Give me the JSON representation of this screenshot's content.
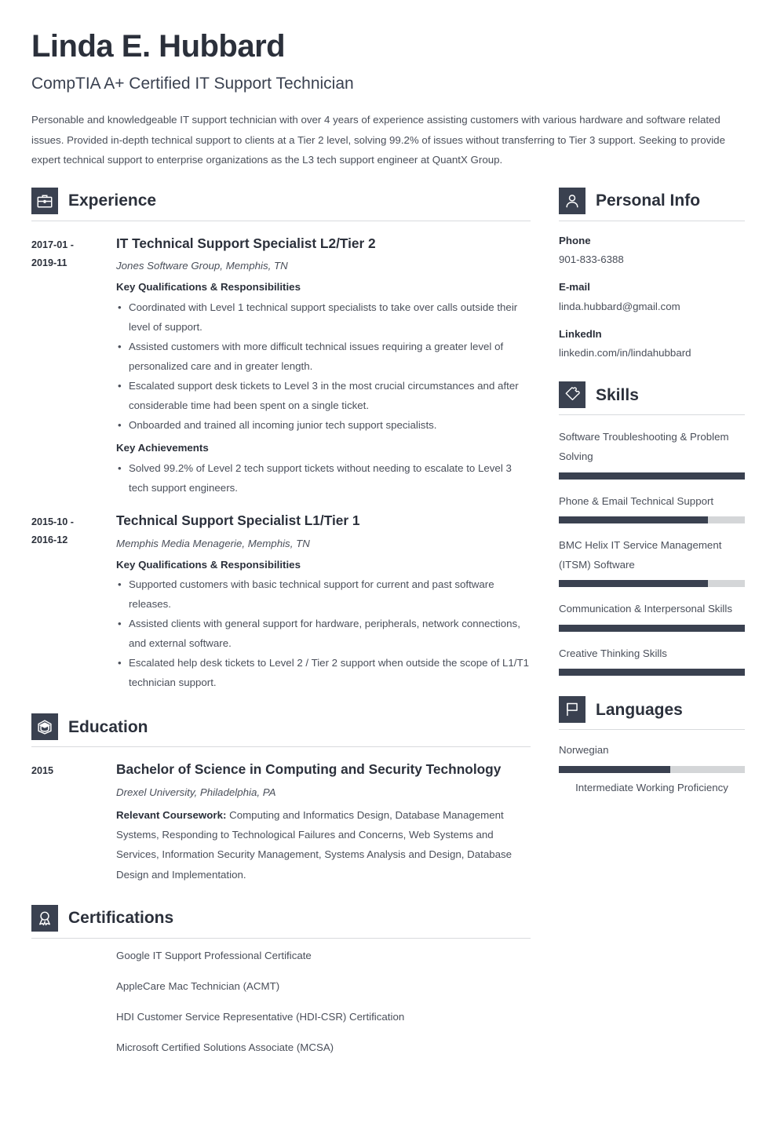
{
  "header": {
    "name": "Linda E. Hubbard",
    "job_title": "CompTIA A+ Certified IT Support Technician",
    "summary": "Personable and knowledgeable IT support technician with over 4 years of experience assisting customers with various hardware and software related issues. Provided in-depth technical support to clients at a Tier 2 level, solving 99.2% of issues without transferring to Tier 3 support. Seeking to provide expert technical support to enterprise organizations as the L3 tech support engineer at QuantX Group."
  },
  "theme": {
    "accent": "#3a4150",
    "heading": "#2b303b",
    "body_text": "#4a4f5a",
    "rule": "#d8dadd",
    "bar_track": "#d4d6d8",
    "bar_fill": "#3a4150"
  },
  "sections": {
    "experience": {
      "title": "Experience",
      "icon": "briefcase-icon",
      "entries": [
        {
          "dates": "2017-01 - 2019-11",
          "date_start": "2017-01 -",
          "date_end": "2019-11",
          "title": "IT Technical Support Specialist L2/Tier 2",
          "organization": "Jones Software Group, Memphis, TN",
          "groups": [
            {
              "heading": "Key Qualifications & Responsibilities",
              "bullets": [
                "Coordinated with Level 1 technical support specialists to take over calls outside their level of support.",
                "Assisted customers with more difficult technical issues requiring a greater level of personalized care and in greater length.",
                "Escalated support desk tickets to Level 3 in the most crucial circumstances and after considerable time had been spent on a single ticket.",
                "Onboarded and trained all incoming junior tech support specialists."
              ]
            },
            {
              "heading": "Key Achievements",
              "bullets": [
                "Solved 99.2% of Level 2 tech support tickets without needing to escalate to Level 3 tech support engineers."
              ]
            }
          ]
        },
        {
          "dates": "2015-10 - 2016-12",
          "date_start": "2015-10 -",
          "date_end": "2016-12",
          "title": "Technical Support Specialist L1/Tier 1",
          "organization": "Memphis Media Menagerie, Memphis, TN",
          "groups": [
            {
              "heading": "Key Qualifications & Responsibilities",
              "bullets": [
                "Supported customers with basic technical support for current and past software releases.",
                "Assisted clients with general support for hardware, peripherals, network connections, and external software.",
                "Escalated help desk tickets to Level 2 / Tier 2 support when outside the scope of L1/T1 technician support."
              ]
            }
          ]
        }
      ]
    },
    "education": {
      "title": "Education",
      "icon": "graduation-cap-icon",
      "entries": [
        {
          "date_start": "2015",
          "title": "Bachelor of Science in Computing and Security Technology",
          "organization": "Drexel University, Philadelphia, PA",
          "coursework_label": "Relevant Coursework:",
          "coursework_text": " Computing and Informatics Design, Database Management Systems, Responding to Technological Failures and Concerns, Web Systems and Services, Information Security Management, Systems Analysis and Design, Database Design and Implementation."
        }
      ]
    },
    "certifications": {
      "title": "Certifications",
      "icon": "award-ribbon-icon",
      "items": [
        "Google IT Support Professional Certificate",
        "AppleCare Mac Technician (ACMT)",
        "HDI Customer Service Representative (HDI-CSR) Certification",
        "Microsoft Certified Solutions Associate (MCSA)"
      ]
    },
    "personal_info": {
      "title": "Personal Info",
      "icon": "person-icon",
      "fields": [
        {
          "label": "Phone",
          "value": "901-833-6388"
        },
        {
          "label": "E-mail",
          "value": "linda.hubbard@gmail.com"
        },
        {
          "label": "LinkedIn",
          "value": "linkedin.com/in/lindahubbard"
        }
      ]
    },
    "skills": {
      "title": "Skills",
      "icon": "puzzle-piece-icon",
      "items": [
        {
          "name": "Software Troubleshooting & Problem Solving",
          "level": 100
        },
        {
          "name": "Phone & Email Technical Support",
          "level": 80
        },
        {
          "name": "BMC Helix IT Service Management (ITSM) Software",
          "level": 80
        },
        {
          "name": "Communication & Interpersonal Skills",
          "level": 100
        },
        {
          "name": "Creative Thinking Skills",
          "level": 100
        }
      ]
    },
    "languages": {
      "title": "Languages",
      "icon": "flag-icon",
      "items": [
        {
          "name": "Norwegian",
          "level": 60,
          "proficiency": "Intermediate Working Proficiency"
        }
      ]
    }
  }
}
